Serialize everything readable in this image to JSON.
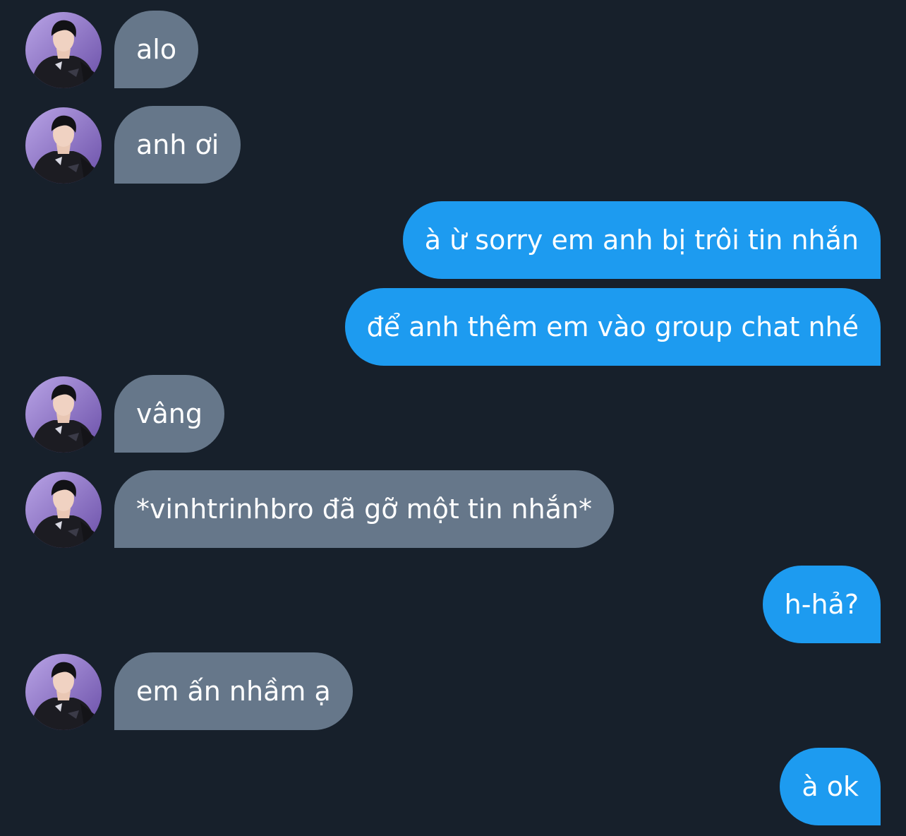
{
  "colors": {
    "background": "#17202b",
    "incoming_bubble": "#66778a",
    "outgoing_bubble": "#1d9bf0",
    "text": "#ffffff"
  },
  "contact": {
    "avatar_icon": "profile-photo-avatar"
  },
  "messages": [
    {
      "direction": "incoming",
      "text": "alo"
    },
    {
      "direction": "incoming",
      "text": "anh ơi"
    },
    {
      "direction": "outgoing",
      "text": "à ừ sorry em anh bị trôi tin nhắn"
    },
    {
      "direction": "outgoing",
      "text": "để anh thêm em vào group chat nhé"
    },
    {
      "direction": "incoming",
      "text": "vâng"
    },
    {
      "direction": "incoming",
      "text": "*vinhtrinhbro đã gỡ một tin nhắn*"
    },
    {
      "direction": "outgoing",
      "text": "h-hả?"
    },
    {
      "direction": "incoming",
      "text": "em ấn nhầm ạ"
    },
    {
      "direction": "outgoing",
      "text": "à ok"
    }
  ]
}
